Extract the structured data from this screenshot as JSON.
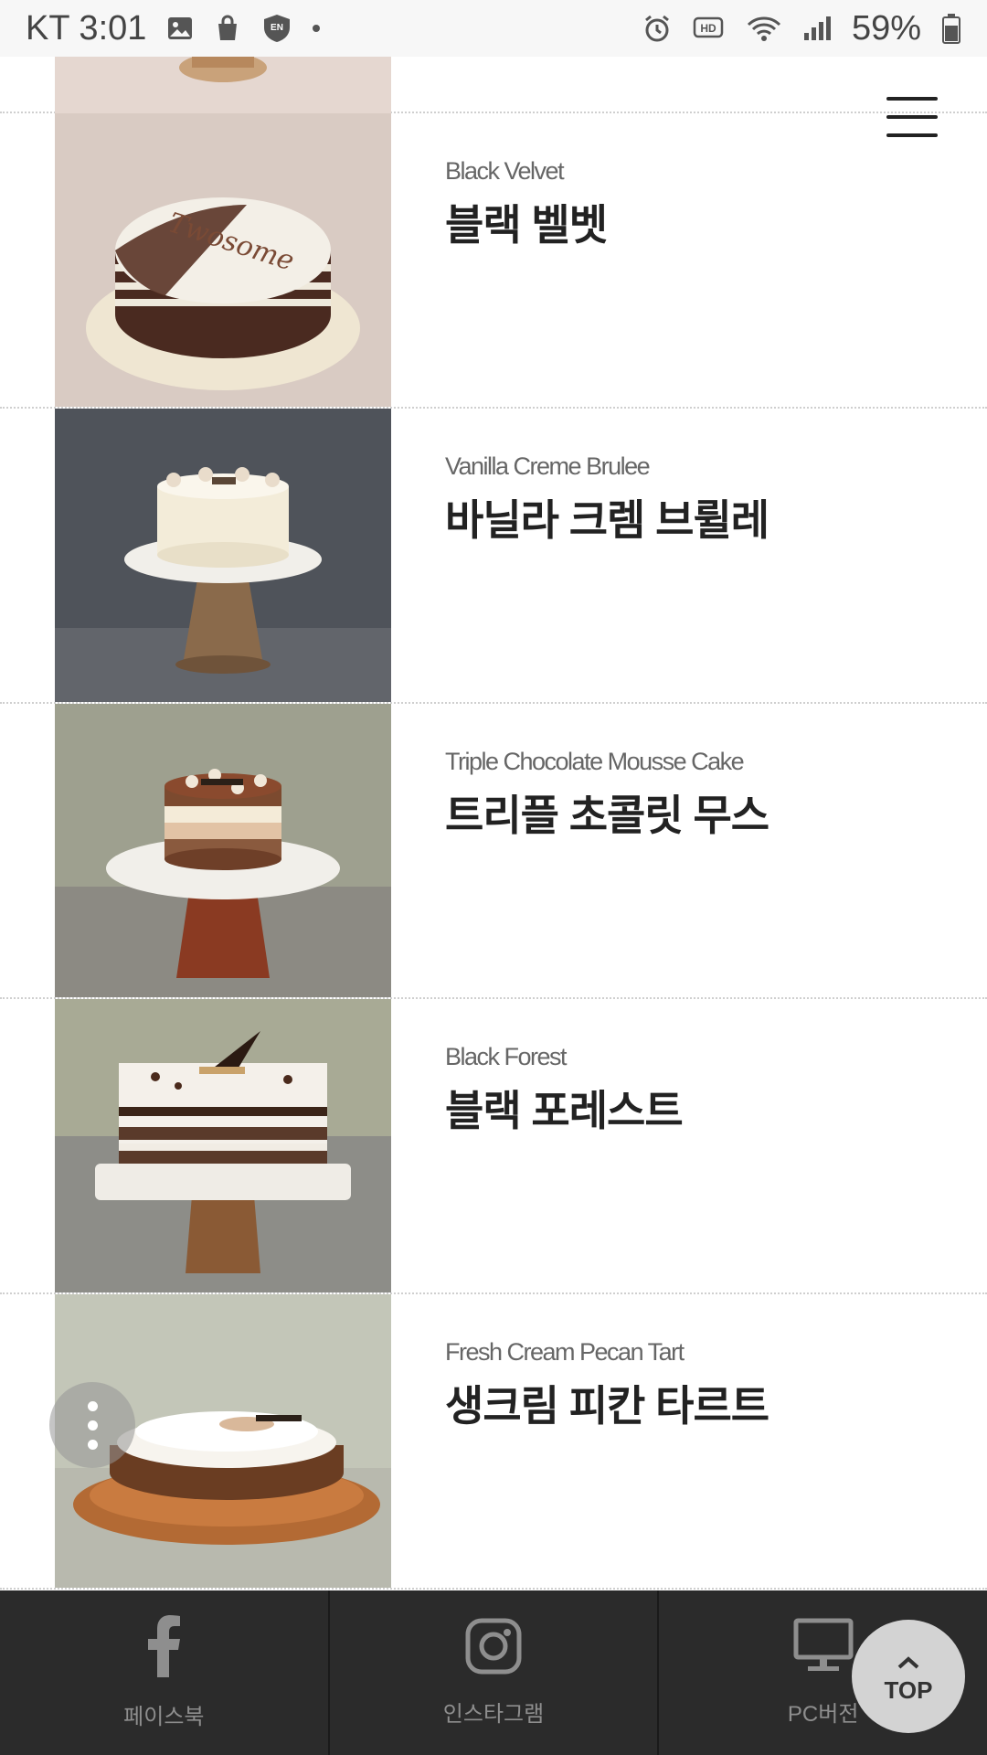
{
  "status_bar": {
    "carrier_time": "KT 3:01",
    "battery": "59%",
    "left_icons": [
      "gallery-icon",
      "shopping-bag-icon",
      "vpn-shield-icon",
      "dot-icon"
    ],
    "right_icons": [
      "alarm-icon",
      "hd-icon",
      "wifi-icon",
      "signal-icon",
      "battery-icon"
    ]
  },
  "menu": {
    "icon": "hamburger-icon"
  },
  "products": [
    {
      "en": "Black Velvet",
      "ko": "블랙 벨벳",
      "bg": "#d9cbc3",
      "type": "black-velvet"
    },
    {
      "en": "Vanilla Creme Brulee",
      "ko": "바닐라 크렘 브륄레",
      "bg": "#4f535a",
      "type": "vanilla"
    },
    {
      "en": "Triple Chocolate Mousse Cake",
      "ko": "트리플 초콜릿 무스",
      "bg": "#9ea08f",
      "type": "triple"
    },
    {
      "en": "Black Forest",
      "ko": "블랙 포레스트",
      "bg": "#a8aa95",
      "type": "forest"
    },
    {
      "en": "Fresh Cream Pecan Tart",
      "ko": "생크림 피칸 타르트",
      "bg": "#c3c6b8",
      "type": "tart"
    }
  ],
  "footer": {
    "items": [
      {
        "label": "페이스북",
        "icon": "facebook-icon"
      },
      {
        "label": "인스타그램",
        "icon": "instagram-icon"
      },
      {
        "label": "PC버전",
        "icon": "monitor-icon"
      }
    ],
    "top_label": "TOP"
  },
  "colors": {
    "footer_bg": "#2b2b2b",
    "text_dark": "#222222",
    "text_sub": "#666666"
  }
}
